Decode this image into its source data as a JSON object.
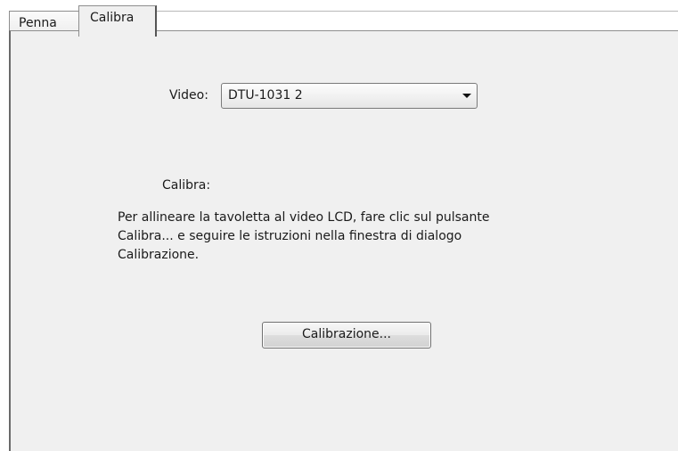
{
  "tabs": [
    {
      "label": "Penna",
      "active": false
    },
    {
      "label": "Calibra",
      "active": true
    }
  ],
  "video": {
    "label": "Video:",
    "selected": "DTU-1031 2"
  },
  "calibrate_section": {
    "heading": "Calibra:",
    "instructions": "Per allineare la tavoletta al video LCD, fare clic sul pulsante\nCalibra... e seguire le istruzioni nella finestra di dialogo\nCalibrazione.",
    "button_label": "Calibrazione..."
  }
}
